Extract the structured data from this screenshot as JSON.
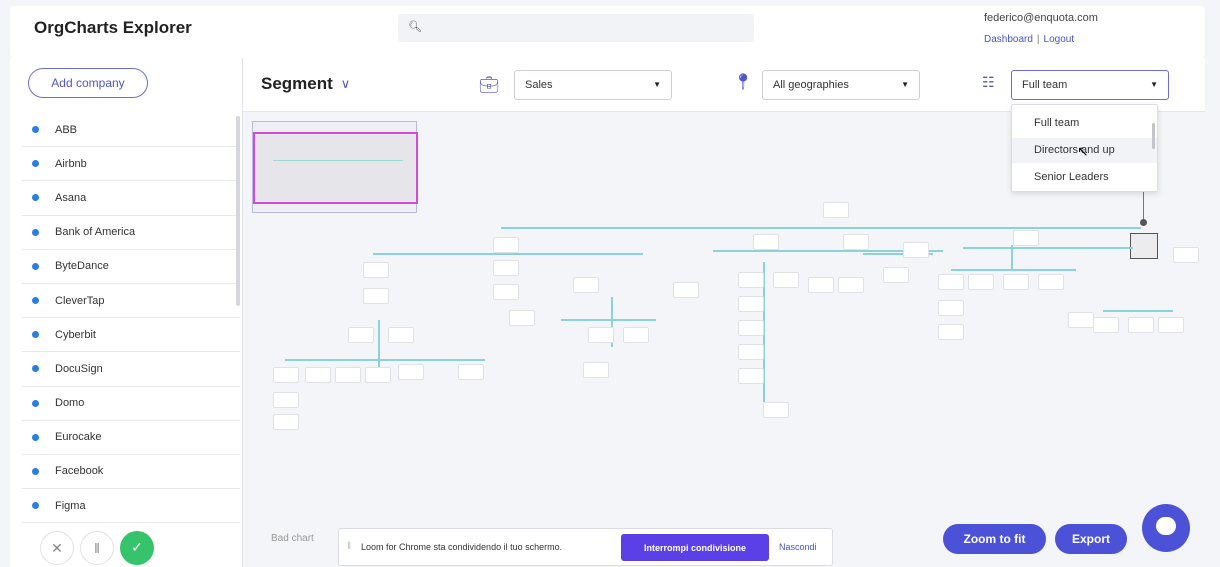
{
  "header": {
    "app_title": "OrgCharts Explorer",
    "search_placeholder": "",
    "user_email": "federico@enquota.com",
    "dashboard_link": "Dashboard",
    "separator": "|",
    "logout_link": "Logout"
  },
  "sidebar": {
    "add_company_label": "Add company",
    "companies": [
      "ABB",
      "Airbnb",
      "Asana",
      "Bank of America",
      "ByteDance",
      "CleverTap",
      "Cyberbit",
      "DocuSign",
      "Domo",
      "Eurocake",
      "Facebook",
      "Figma"
    ]
  },
  "toolbar": {
    "segment_label": "Segment",
    "department_value": "Sales",
    "geography_value": "All geographies",
    "team_value": "Full team"
  },
  "team_dropdown": {
    "options": [
      "Full team",
      "Directors and up",
      "Senior Leaders"
    ],
    "hovered_index": 1
  },
  "canvas": {
    "bad_chart_label": "Bad chart"
  },
  "loom": {
    "message": "Loom for Chrome sta condividendo il tuo schermo.",
    "stop_label": "Interrompi condivisione",
    "hide_label": "Nascondi"
  },
  "actions": {
    "zoom_to_fit_label": "Zoom to fit",
    "export_label": "Export"
  },
  "colors": {
    "accent": "#4c52d8",
    "company_dot": "#2a7de1",
    "org_line": "#8ad3d6",
    "minimap_viewport": "#d24bd8",
    "loom_button": "#5b40e8",
    "record_ok": "#35c46b"
  }
}
